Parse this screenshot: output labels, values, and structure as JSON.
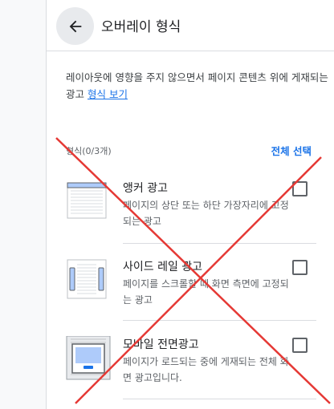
{
  "header": {
    "title": "오버레이 형식",
    "back_icon": "arrow-back-icon"
  },
  "description": {
    "text": "레이아웃에 영향을 주지 않으면서 페이지 콘텐츠 위에 게재되는 광고 ",
    "link": "형식 보기"
  },
  "formats": {
    "count_label": "형식(0/3개)",
    "select_all": "전체 선택",
    "items": [
      {
        "title": "앵커 광고",
        "description": "페이지의 상단 또는 하단 가장자리에 고정되는 광고",
        "icon": "anchor-ad-icon",
        "checked": false
      },
      {
        "title": "사이드 레일 광고",
        "description": "페이지를 스크롤할 때 화면 측면에 고정되는 광고",
        "icon": "side-rail-ad-icon",
        "checked": false
      },
      {
        "title": "모바일 전면광고",
        "description": "페이지가 로드되는 중에 게재되는 전체 화면 광고입니다.",
        "icon": "mobile-interstitial-ad-icon",
        "checked": false
      }
    ]
  },
  "colors": {
    "accent": "#1a73e8",
    "cross": "#e53935"
  }
}
